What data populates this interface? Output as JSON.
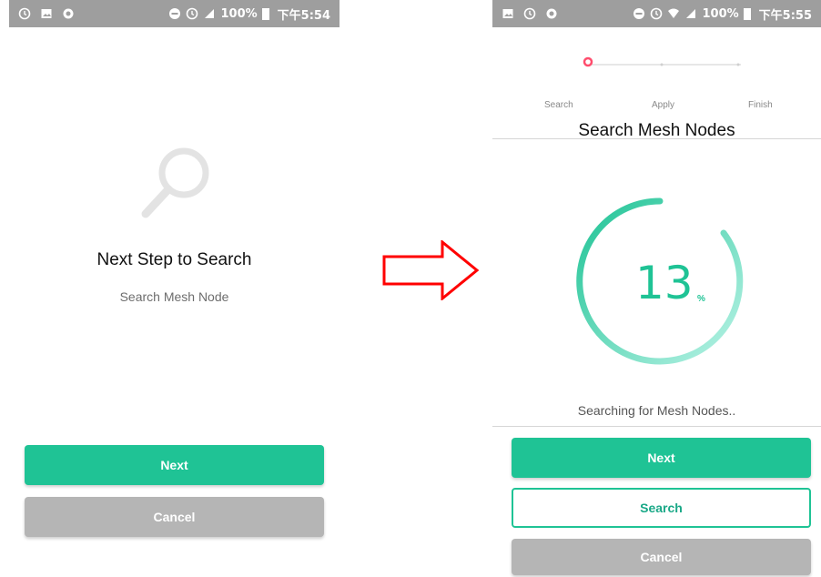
{
  "left_screen": {
    "status": {
      "battery": "100%",
      "time": "下午5:54"
    },
    "title": "Next Step to Search",
    "subtitle": "Search Mesh Node",
    "next_label": "Next",
    "cancel_label": "Cancel"
  },
  "right_screen": {
    "status": {
      "battery": "100%",
      "time": "下午5:55"
    },
    "steps": [
      "Search",
      "Apply",
      "Finish"
    ],
    "title": "Search Mesh Nodes",
    "progress": {
      "value": "13",
      "unit": "%"
    },
    "status_text": "Searching for Mesh Nodes..",
    "next_label": "Next",
    "search_label": "Search",
    "cancel_label": "Cancel"
  },
  "colors": {
    "accent": "#1fc395",
    "step_active": "#ff4d6d",
    "arrow": "#ff0000"
  }
}
